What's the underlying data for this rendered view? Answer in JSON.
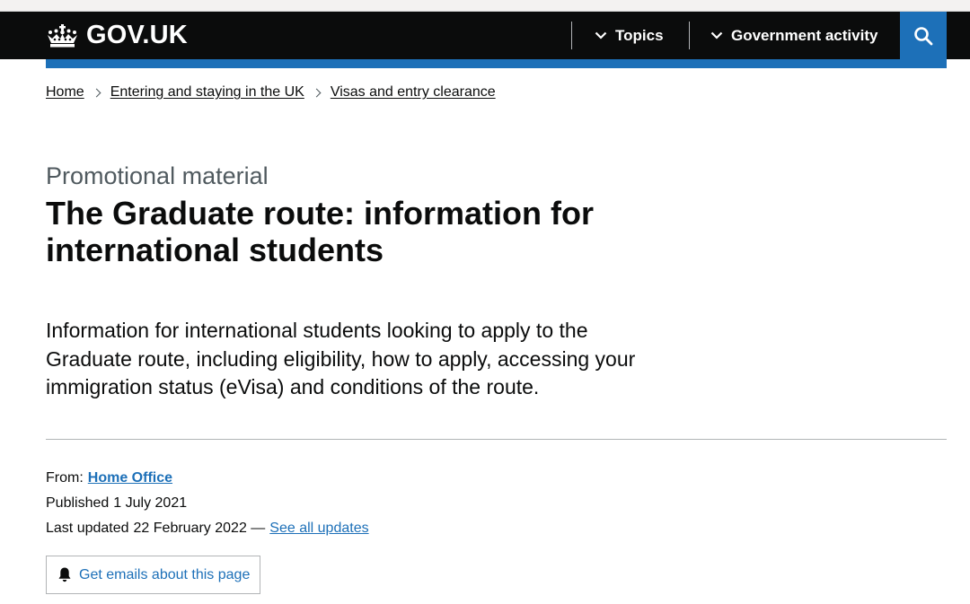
{
  "header": {
    "logo_text": "GOV.UK",
    "nav": [
      {
        "label": "Topics"
      },
      {
        "label": "Government activity"
      }
    ],
    "colors": {
      "header_bg": "#0b0c0c",
      "accent": "#1d70b8"
    }
  },
  "breadcrumb": [
    {
      "label": "Home"
    },
    {
      "label": "Entering and staying in the UK"
    },
    {
      "label": "Visas and entry clearance"
    }
  ],
  "page": {
    "caption": "Promotional material",
    "title": "The Graduate route: information for international students",
    "lead": "Information for international students looking to apply to the Graduate route, including eligibility, how to apply, accessing your immigration status (eVisa) and conditions of the route."
  },
  "meta": {
    "from_label": "From:",
    "from_org": "Home Office",
    "published_label": "Published",
    "published_date": "1 July 2021",
    "updated_label": "Last updated",
    "updated_date": "22 February 2022 —",
    "see_updates": "See all updates"
  },
  "email_button": {
    "label": "Get emails about this page",
    "icon": "bell-icon"
  }
}
